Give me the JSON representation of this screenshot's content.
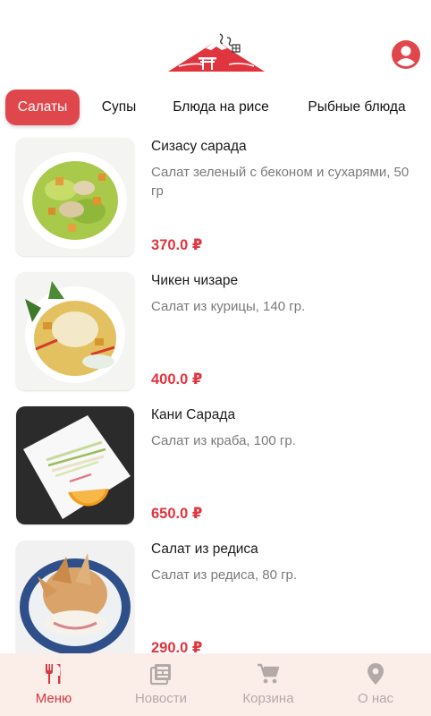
{
  "colors": {
    "accent": "#e0474c",
    "price": "#e0343e",
    "nav_bg": "#fbeee9",
    "nav_inactive": "#b3aaa7"
  },
  "header": {
    "logo_icon": "mountain-torii-logo",
    "profile_icon": "account-circle-icon"
  },
  "tabs": [
    {
      "label": "Салаты",
      "active": true
    },
    {
      "label": "Супы",
      "active": false
    },
    {
      "label": "Блюда на рисе",
      "active": false
    },
    {
      "label": "Рыбные блюда",
      "active": false
    }
  ],
  "items": [
    {
      "name": "Сизасу сарада",
      "description": "Салат зеленый с беконом и сухарями, 50 гр",
      "price": "370.0 ₽"
    },
    {
      "name": "Чикен чизаре",
      "description": "Салат из курицы, 140 гр.",
      "price": "400.0 ₽"
    },
    {
      "name": "Кани Сарада",
      "description": "Салат из краба, 100 гр.",
      "price": "650.0 ₽"
    },
    {
      "name": "Салат из редиса",
      "description": "Салат из редиса, 80 гр.",
      "price": "290.0 ₽"
    }
  ],
  "bottom_nav": [
    {
      "label": "Меню",
      "icon": "fork-knife-icon",
      "active": true
    },
    {
      "label": "Новости",
      "icon": "news-icon",
      "active": false
    },
    {
      "label": "Корзина",
      "icon": "cart-icon",
      "active": false
    },
    {
      "label": "О нас",
      "icon": "location-pin-icon",
      "active": false
    }
  ]
}
